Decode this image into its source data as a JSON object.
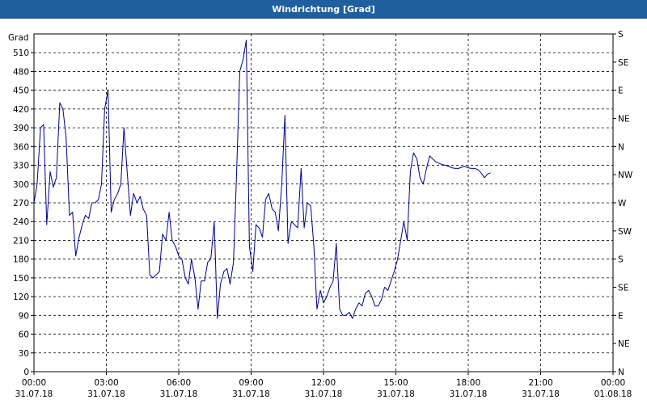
{
  "window": {
    "title": "Windrichtung [Grad]"
  },
  "chart_data": {
    "type": "line",
    "title": "Windrichtung [Grad]",
    "ylabel": "Grad",
    "ylim": [
      0,
      540
    ],
    "xlim_hours": [
      0,
      24
    ],
    "yticks_left": [
      0,
      30,
      60,
      90,
      120,
      150,
      180,
      210,
      240,
      270,
      300,
      330,
      360,
      390,
      420,
      450,
      480,
      510
    ],
    "yticks_right": [
      {
        "value": 0,
        "label": "N"
      },
      {
        "value": 45,
        "label": "NE"
      },
      {
        "value": 90,
        "label": "E"
      },
      {
        "value": 135,
        "label": "SE"
      },
      {
        "value": 180,
        "label": "S"
      },
      {
        "value": 225,
        "label": "SW"
      },
      {
        "value": 270,
        "label": "W"
      },
      {
        "value": 315,
        "label": "NW"
      },
      {
        "value": 360,
        "label": "N"
      },
      {
        "value": 405,
        "label": "NE"
      },
      {
        "value": 450,
        "label": "E"
      },
      {
        "value": 495,
        "label": "SE"
      },
      {
        "value": 540,
        "label": "S"
      }
    ],
    "xticks": [
      {
        "hour": 0,
        "time": "00:00",
        "date": "31.07.18"
      },
      {
        "hour": 3,
        "time": "03:00",
        "date": "31.07.18"
      },
      {
        "hour": 6,
        "time": "06:00",
        "date": "31.07.18"
      },
      {
        "hour": 9,
        "time": "09:00",
        "date": "31.07.18"
      },
      {
        "hour": 12,
        "time": "12:00",
        "date": "31.07.18"
      },
      {
        "hour": 15,
        "time": "15:00",
        "date": "31.07.18"
      },
      {
        "hour": 18,
        "time": "18:00",
        "date": "31.07.18"
      },
      {
        "hour": 21,
        "time": "21:00",
        "date": "31.07.18"
      },
      {
        "hour": 24,
        "time": "00:00",
        "date": "01.08.18"
      }
    ],
    "grid": true,
    "series": [
      {
        "color": "#00008b",
        "hours": [
          0.0,
          0.13,
          0.27,
          0.4,
          0.53,
          0.67,
          0.8,
          0.93,
          1.07,
          1.2,
          1.33,
          1.47,
          1.6,
          1.73,
          1.87,
          2.0,
          2.13,
          2.27,
          2.4,
          2.53,
          2.67,
          2.8,
          2.93,
          3.07,
          3.2,
          3.33,
          3.47,
          3.6,
          3.73,
          3.87,
          4.0,
          4.13,
          4.27,
          4.4,
          4.53,
          4.67,
          4.8,
          4.93,
          5.07,
          5.2,
          5.33,
          5.47,
          5.6,
          5.73,
          5.87,
          6.0,
          6.13,
          6.27,
          6.4,
          6.53,
          6.67,
          6.8,
          6.93,
          7.07,
          7.2,
          7.33,
          7.47,
          7.6,
          7.73,
          7.87,
          8.0,
          8.13,
          8.27,
          8.4,
          8.53,
          8.67,
          8.8,
          8.93,
          9.07,
          9.2,
          9.33,
          9.47,
          9.6,
          9.73,
          9.87,
          10.0,
          10.13,
          10.27,
          10.4,
          10.53,
          10.67,
          10.8,
          10.93,
          11.07,
          11.2,
          11.33,
          11.47,
          11.6,
          11.73,
          11.87,
          12.0,
          12.13,
          12.27,
          12.4,
          12.53,
          12.67,
          12.8,
          12.93,
          13.07,
          13.2,
          13.33,
          13.47,
          13.6,
          13.73,
          13.87,
          14.0,
          14.13,
          14.27,
          14.4,
          14.53,
          14.67,
          14.8,
          14.93,
          15.07,
          15.2,
          15.33,
          15.47,
          15.6,
          15.73,
          15.87,
          16.0,
          16.13,
          16.27,
          16.4,
          16.53,
          16.67,
          16.8,
          16.93,
          17.07,
          17.2,
          17.33,
          17.47,
          17.6,
          17.73,
          17.87,
          18.0,
          18.13,
          18.27,
          18.4,
          18.53,
          18.67,
          18.8,
          18.93,
          19.07,
          19.2,
          19.33,
          19.47,
          19.6,
          19.73,
          19.87,
          20.0,
          20.13,
          20.27,
          20.4,
          20.53,
          20.67,
          20.8,
          20.93,
          21.07,
          21.2,
          21.33,
          21.47,
          21.6,
          21.73,
          21.87,
          22.0,
          22.13,
          22.27,
          22.4,
          22.53,
          22.67,
          22.8,
          22.93,
          23.07,
          23.2,
          23.33,
          23.47,
          23.6,
          23.73,
          23.87,
          24.0
        ],
        "values": [
          270,
          300,
          390,
          395,
          235,
          320,
          295,
          310,
          430,
          420,
          375,
          250,
          255,
          185,
          215,
          235,
          250,
          245,
          270,
          270,
          275,
          300,
          420,
          450,
          255,
          275,
          285,
          300,
          390,
          315,
          250,
          285,
          270,
          280,
          260,
          250,
          155,
          150,
          155,
          160,
          220,
          210,
          255,
          210,
          200,
          185,
          180,
          150,
          140,
          180,
          150,
          100,
          145,
          145,
          175,
          180,
          240,
          85,
          140,
          160,
          165,
          140,
          175,
          320,
          480,
          500,
          530,
          200,
          160,
          235,
          230,
          215,
          275,
          285,
          260,
          255,
          225,
          300,
          410,
          205,
          240,
          235,
          230,
          325,
          230,
          270,
          265,
          200,
          100,
          130,
          110,
          120,
          135,
          145,
          205,
          100,
          90,
          90,
          95,
          85,
          100,
          110,
          105,
          125,
          130,
          120,
          105,
          105,
          115,
          135,
          130,
          145,
          160,
          180,
          210,
          240,
          210,
          320,
          350,
          340,
          310,
          300,
          325,
          345,
          340,
          335,
          333,
          331,
          330,
          328,
          326,
          325,
          325,
          327,
          328,
          326,
          325,
          325,
          323,
          318,
          310,
          316,
          318
        ]
      }
    ]
  }
}
